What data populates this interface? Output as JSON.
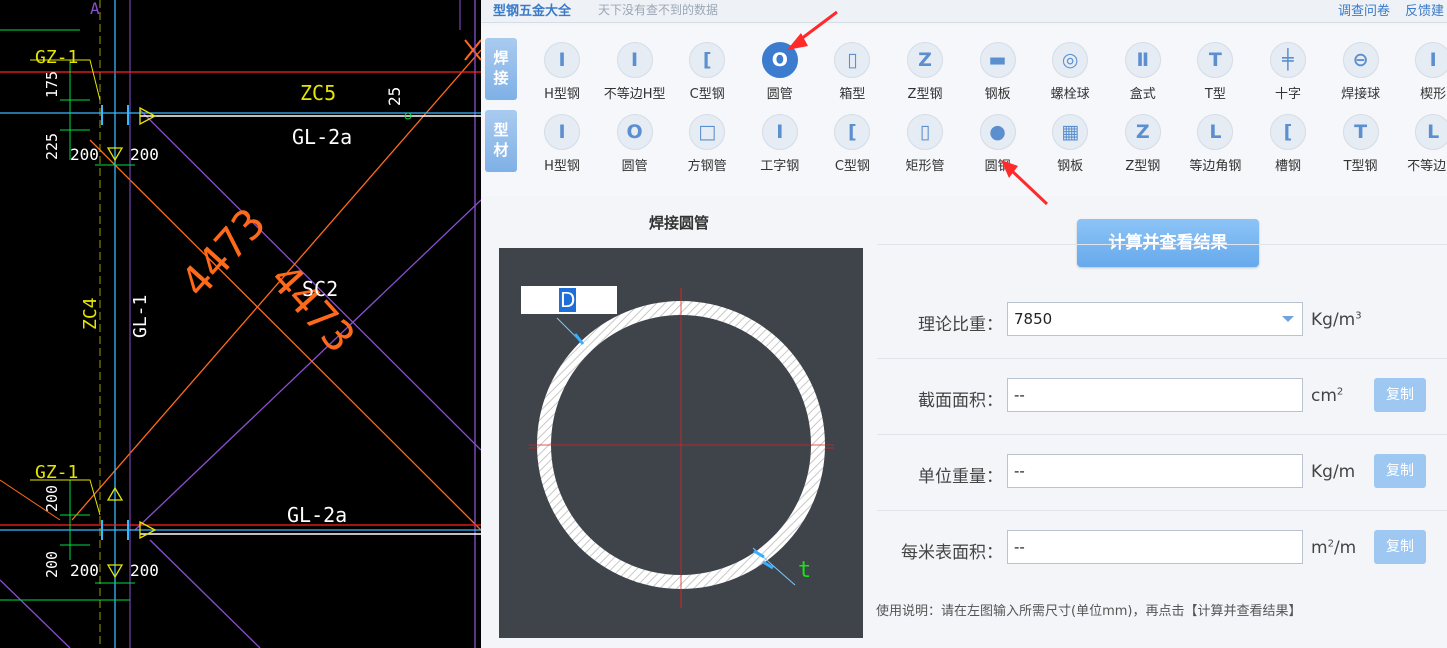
{
  "cad": {
    "labels": {
      "gz1_top": "GZ-1",
      "zc5": "ZC5",
      "gl2a_top": "GL-2a",
      "dim_25": "25",
      "dim_175": "175",
      "dim_225": "225",
      "dim_200_a": "200",
      "dim_200_b": "200",
      "dim_4473_a": "4473",
      "dim_4473_b": "4473",
      "sc2": "SC2",
      "zc4": "ZC4",
      "gl1": "GL-1",
      "gz1_bot": "GZ-1",
      "dim_200_c": "200",
      "gl2a_bot": "GL-2a",
      "dim_200_d": "200",
      "dim_200_e": "200",
      "dim_200_f": "200",
      "dim_partial_top": "A"
    }
  },
  "app": {
    "brand": "型钢五金大全",
    "slogan": "天下没有查不到的数据",
    "survey": "调查问卷",
    "feedback": "反馈建",
    "categories": [
      {
        "chars": [
          "焊",
          "接"
        ]
      },
      {
        "chars": [
          "型",
          "材"
        ]
      }
    ],
    "row1": [
      {
        "label": "H型钢",
        "icon": "h-beam-icon",
        "glyph": "I"
      },
      {
        "label": "不等边H型",
        "icon": "unequal-h-icon",
        "glyph": "I"
      },
      {
        "label": "C型钢",
        "icon": "c-channel-icon",
        "glyph": "["
      },
      {
        "label": "圆管",
        "icon": "round-tube-icon",
        "glyph": "O",
        "active": true
      },
      {
        "label": "箱型",
        "icon": "box-section-icon",
        "glyph": "▯"
      },
      {
        "label": "Z型钢",
        "icon": "z-section-icon",
        "glyph": "Z"
      },
      {
        "label": "钢板",
        "icon": "steel-plate-icon",
        "glyph": "▬"
      },
      {
        "label": "螺栓球",
        "icon": "bolt-ball-icon",
        "glyph": "◎"
      },
      {
        "label": "盒式",
        "icon": "box-type-icon",
        "glyph": "Ⅱ"
      },
      {
        "label": "T型",
        "icon": "t-section-icon",
        "glyph": "T"
      },
      {
        "label": "十字",
        "icon": "cross-section-icon",
        "glyph": "╪"
      },
      {
        "label": "焊接球",
        "icon": "welded-ball-icon",
        "glyph": "⊖"
      },
      {
        "label": "楔形",
        "icon": "wedge-icon",
        "glyph": "I"
      }
    ],
    "row2": [
      {
        "label": "H型钢",
        "icon": "h-beam-icon",
        "glyph": "I"
      },
      {
        "label": "圆管",
        "icon": "round-tube-icon",
        "glyph": "O"
      },
      {
        "label": "方钢管",
        "icon": "square-tube-icon",
        "glyph": "□"
      },
      {
        "label": "工字钢",
        "icon": "i-beam-icon",
        "glyph": "I"
      },
      {
        "label": "C型钢",
        "icon": "c-channel-icon",
        "glyph": "["
      },
      {
        "label": "矩形管",
        "icon": "rect-tube-icon",
        "glyph": "▯"
      },
      {
        "label": "圆钢",
        "icon": "round-bar-icon",
        "glyph": "●"
      },
      {
        "label": "钢板",
        "icon": "steel-plate-icon",
        "glyph": "▦"
      },
      {
        "label": "Z型钢",
        "icon": "z-section-icon",
        "glyph": "Z"
      },
      {
        "label": "等边角钢",
        "icon": "equal-angle-icon",
        "glyph": "L"
      },
      {
        "label": "槽钢",
        "icon": "channel-icon",
        "glyph": "["
      },
      {
        "label": "T型钢",
        "icon": "t-section-icon",
        "glyph": "T"
      },
      {
        "label": "不等边角",
        "icon": "unequal-angle-icon",
        "glyph": "L"
      }
    ],
    "figure_title": "焊接圆管",
    "d_label": "D",
    "t_label": "t",
    "calc_button": "计算并查看结果",
    "fields": [
      {
        "label": "理论比重：",
        "value": "7850",
        "unit": "Kg/m",
        "unit_sup": "3",
        "dropdown": true
      },
      {
        "label": "截面面积：",
        "value": "--",
        "unit": "cm",
        "unit_sup": "2",
        "copy": "复制"
      },
      {
        "label": "单位重量：",
        "value": "--",
        "unit": "Kg/m",
        "unit_sup": "",
        "copy": "复制"
      },
      {
        "label": "每米表面积：",
        "value": "--",
        "unit": "m",
        "unit_sup": "2",
        "unit_tail": "/m",
        "copy": "复制"
      }
    ],
    "usage": "使用说明：请在左图输入所需尺寸(单位mm)，再点击【计算并查看结果】"
  }
}
